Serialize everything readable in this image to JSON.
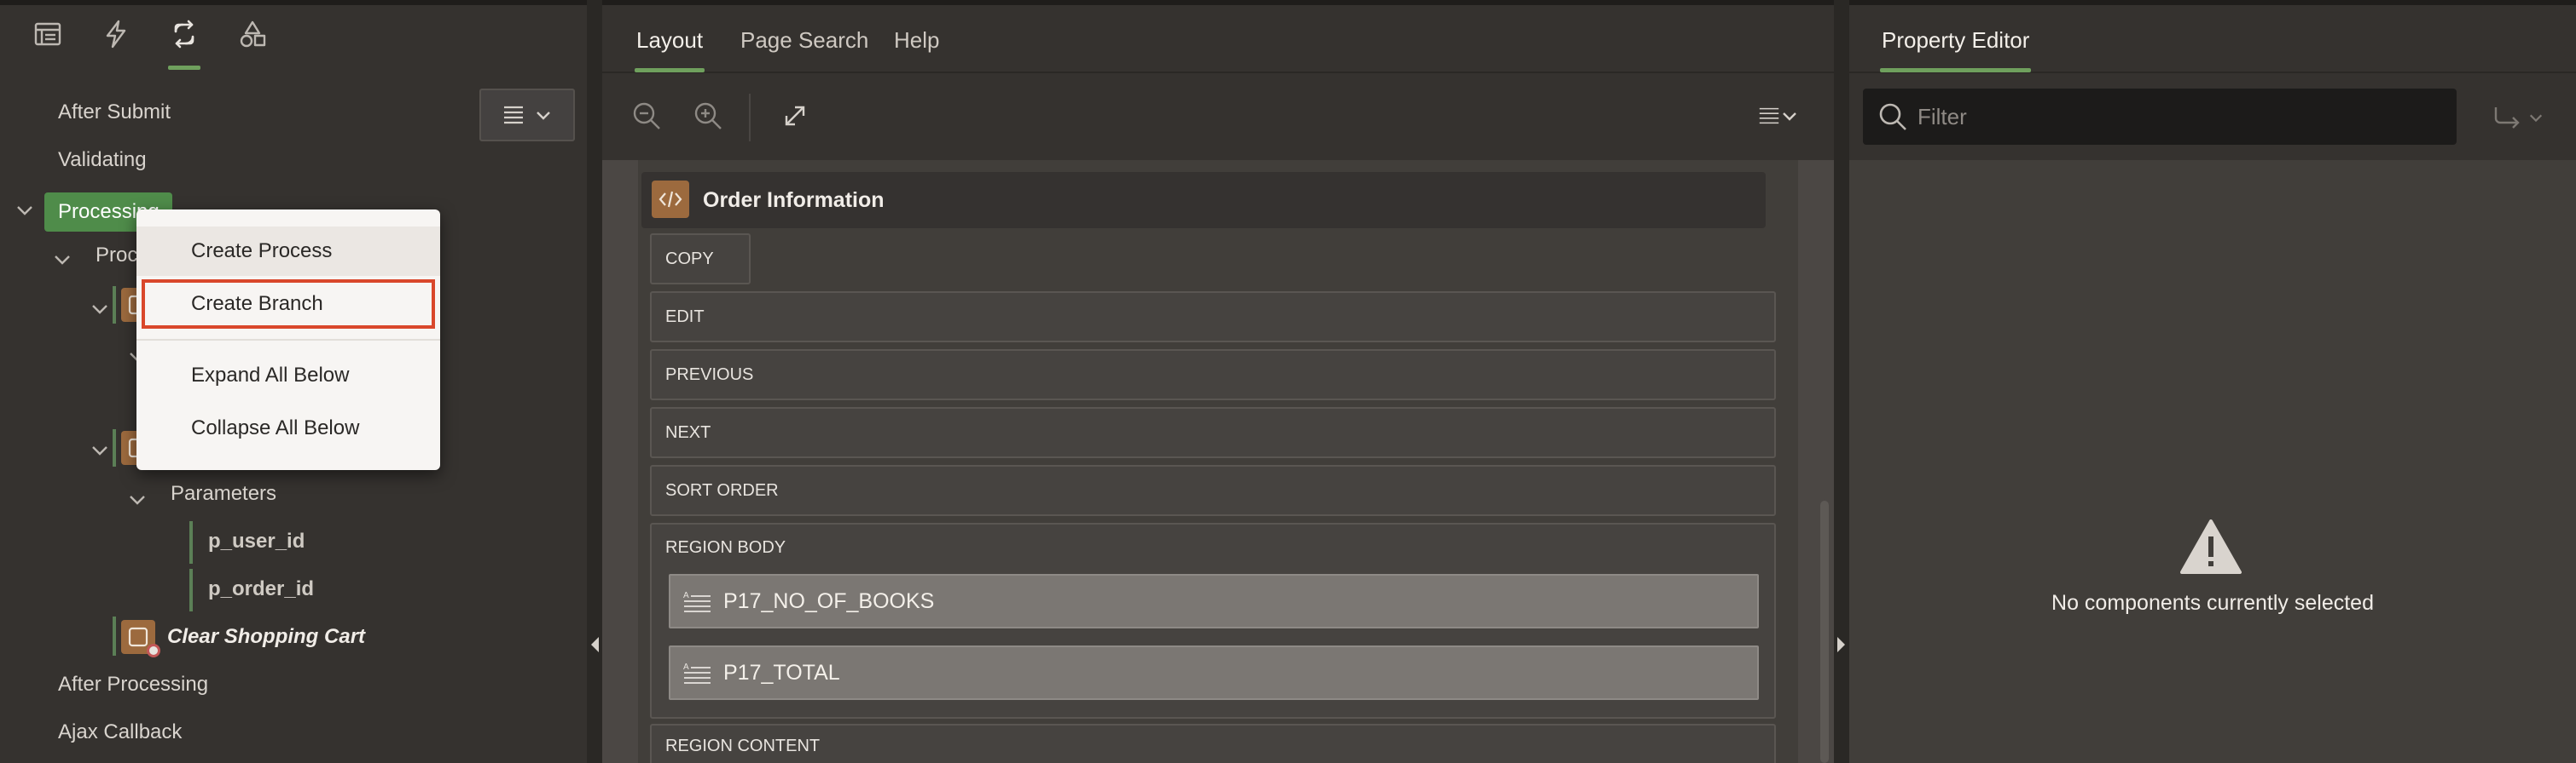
{
  "left_panel": {
    "tabs": [
      {
        "icon": "page-rendering-icon"
      },
      {
        "icon": "dynamic-actions-icon"
      },
      {
        "icon": "processing-icon",
        "active": true
      },
      {
        "icon": "shared-components-icon"
      }
    ],
    "tree_menu_icon": "menu-chevron-icon",
    "tree": {
      "after_submit": "After Submit",
      "validating": "Validating",
      "processing": "Processing",
      "processes_partial": "Proc",
      "parameters": "Parameters",
      "param_user": "p_user_id",
      "param_order": "p_order_id",
      "clear_cart": "Clear Shopping Cart",
      "after_processing": "After Processing",
      "ajax_callback": "Ajax Callback"
    },
    "context_menu": {
      "create_process": "Create Process",
      "create_branch": "Create Branch",
      "expand_all": "Expand All Below",
      "collapse_all": "Collapse All Below"
    }
  },
  "middle_panel": {
    "tabs": {
      "layout": "Layout",
      "page_search": "Page Search",
      "help": "Help"
    },
    "region_title": "Order Information",
    "slots": {
      "copy": "COPY",
      "edit": "EDIT",
      "previous": "PREVIOUS",
      "next": "NEXT",
      "sort_order": "SORT ORDER",
      "region_body": "REGION BODY",
      "region_content": "REGION CONTENT"
    },
    "items": {
      "books": "P17_NO_OF_BOOKS",
      "total": "P17_TOTAL"
    }
  },
  "right_panel": {
    "tab": "Property Editor",
    "filter_placeholder": "Filter",
    "empty_message": "No components currently selected"
  },
  "colors": {
    "accent_green": "#6fa05d",
    "selected_node": "#4f8c4a",
    "process_icon": "#9c6a3e",
    "highlight_border": "#d9472b"
  }
}
